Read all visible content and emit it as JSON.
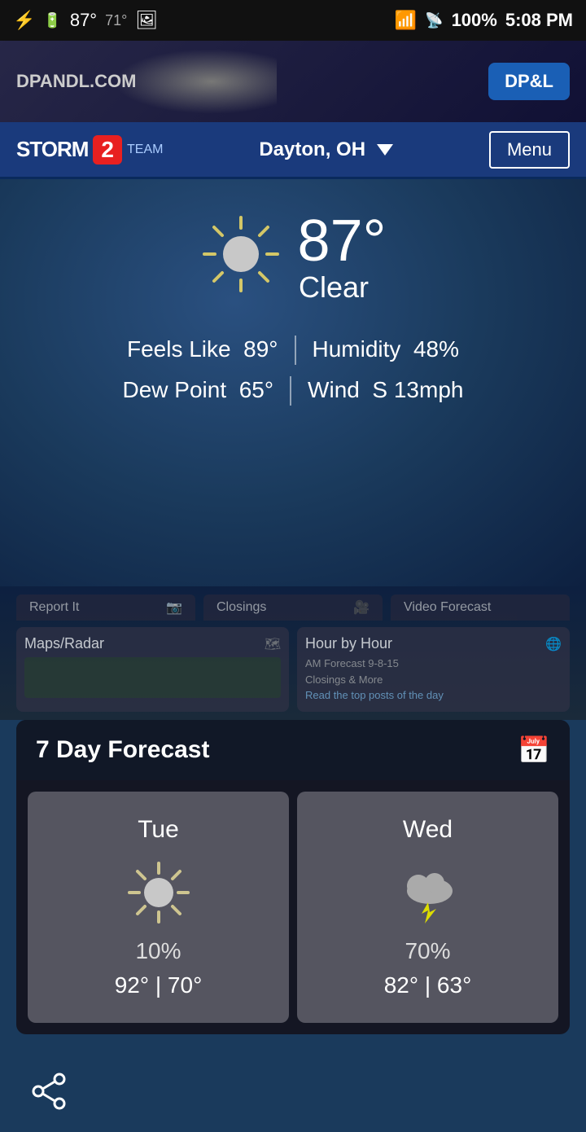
{
  "statusBar": {
    "leftIcons": [
      "usb-icon",
      "battery-100-icon",
      "temp-icon",
      "photo-icon"
    ],
    "temp": "87°",
    "tempLow": "71°",
    "wifi": "wifi-icon",
    "signal": "signal-icon",
    "battery": "100%",
    "time": "5:08 PM"
  },
  "adBanner": {
    "leftText": "DPANDL.COM",
    "logoText": "DP&L"
  },
  "header": {
    "appName": "STORM",
    "badgeNumber": "2",
    "teamLabel": "TEAM",
    "location": "Dayton, OH",
    "menuLabel": "Menu"
  },
  "currentWeather": {
    "temperature": "87°",
    "condition": "Clear",
    "feelsLike": "89°",
    "humidity": "48%",
    "dewPoint": "65°",
    "wind": "S 13mph",
    "feelsLikeLabel": "Feels Like",
    "humidityLabel": "Humidity",
    "dewPointLabel": "Dew Point",
    "windLabel": "Wind"
  },
  "miniCards": [
    {
      "title": "Maps/Radar",
      "icon": "map-icon"
    },
    {
      "title": "Hour by Hour",
      "icon": "clock-icon",
      "subItems": [
        "AM Forecast 9-8-15",
        "Closings & More",
        "Read the top posts of the day"
      ]
    }
  ],
  "forecastSection": {
    "title": "7 Day Forecast",
    "iconLabel": "calendar-icon",
    "days": [
      {
        "day": "Tue",
        "icon": "sunny-icon",
        "precipPercent": "10%",
        "high": "92°",
        "low": "70°"
      },
      {
        "day": "Wed",
        "icon": "thunderstorm-icon",
        "precipPercent": "70%",
        "high": "82°",
        "low": "63°"
      }
    ]
  },
  "bottomBar": {
    "shareLabel": "share"
  }
}
